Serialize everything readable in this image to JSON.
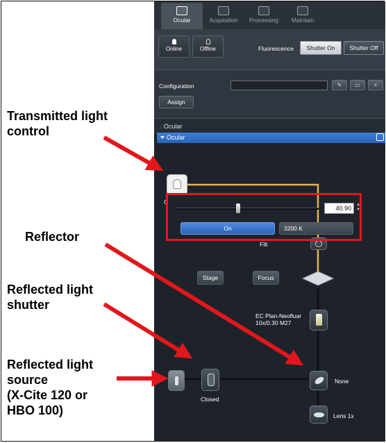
{
  "colors": {
    "panel_bg": "#1b2028",
    "accent_blue": "#3f7fd8",
    "light_path": "#e8b25a",
    "annotation_red": "#e2171b"
  },
  "tabs": [
    {
      "label": "Ocular",
      "icon": "eyepiece-icon",
      "active": true
    },
    {
      "label": "Acquisition",
      "icon": "camera-icon",
      "active": false
    },
    {
      "label": "Processing",
      "icon": "processing-icon",
      "active": false
    },
    {
      "label": "Maintain",
      "icon": "maintain-icon",
      "active": false
    }
  ],
  "mode": {
    "online_label": "Online",
    "offline_label": "Offline",
    "fluorescence_label": "Fluorescence",
    "shutter_on_label": "Shutter On",
    "shutter_off_label": "Shutter Off"
  },
  "config": {
    "label": "Configuration",
    "value": "",
    "assign_label": "Assign"
  },
  "ocular": {
    "section_label": "Ocular",
    "tool_label": "Ocular"
  },
  "transmitted": {
    "intensity_value": "40.90",
    "on_label": "On",
    "color_temp": "3200 K",
    "partial_label": "C",
    "filter_label": "Filt"
  },
  "path": {
    "stage_label": "Stage",
    "focus_label": "Focus",
    "objective_label_1": "EC Plan-Neofluar",
    "objective_label_2": "10x/0.30 M27",
    "reflector_label": "None",
    "shutter_label": "Closed",
    "lens_label": "Lens 1x"
  },
  "annotations": {
    "transmitted_line1": "Transmitted light",
    "transmitted_line2": "control",
    "reflector": "Reflector",
    "shutter_line1": "Reflected light",
    "shutter_line2": "shutter",
    "source_line1": "Reflected light",
    "source_line2": "source",
    "source_line3": "(X-Cite 120 or",
    "source_line4": "HBO 100)"
  }
}
